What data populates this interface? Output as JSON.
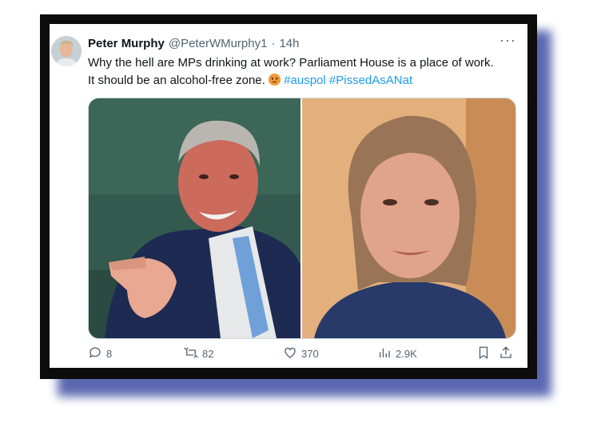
{
  "tweet": {
    "author_name": "Peter Murphy",
    "handle": "@PeterWMurphy1",
    "separator": "·",
    "time": "14h",
    "more": "···",
    "text_line1": "Why the hell are MPs drinking at work? Parliament House is a place of work.",
    "text_line2": "It should be an alcohol-free zone.",
    "hashtag1": "#auspol",
    "hashtag2": "#PissedAsANat"
  },
  "icons": {
    "avatar": "avatar",
    "emoji": "angry-face-icon",
    "reply": "reply-icon",
    "retweet": "retweet-icon",
    "like": "heart-icon",
    "views": "views-icon",
    "bookmark": "bookmark-icon",
    "share": "share-icon"
  },
  "actions": {
    "replies": "8",
    "retweets": "82",
    "likes": "370",
    "views": "2.9K"
  },
  "colors": {
    "accent": "#1d9bf0",
    "frame": "#0c0c0c",
    "shadow": "#4a58a8",
    "muted": "#536471"
  }
}
